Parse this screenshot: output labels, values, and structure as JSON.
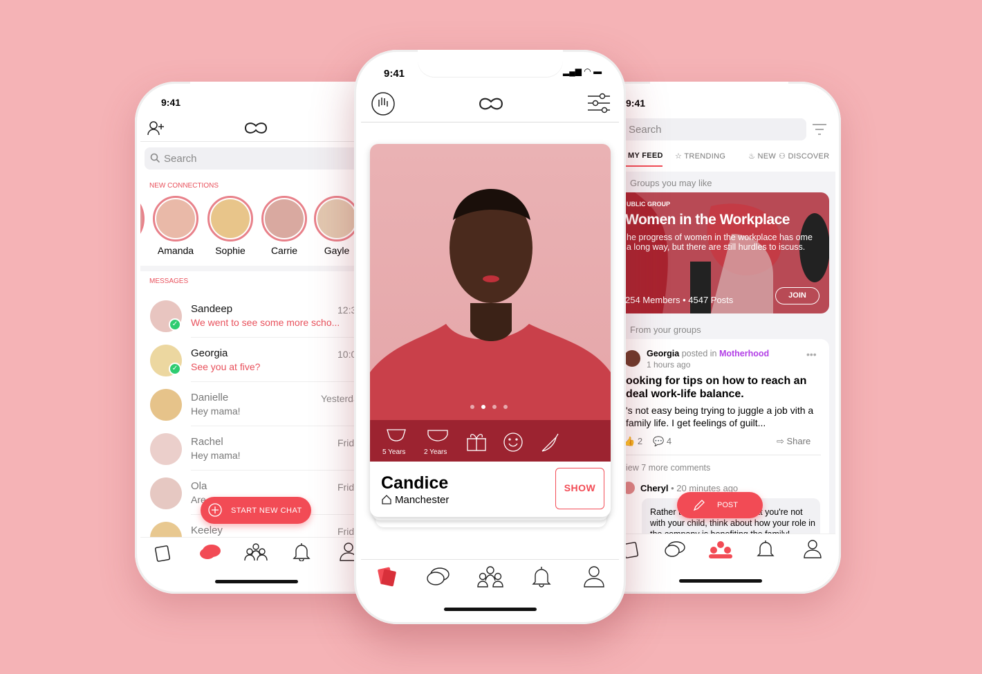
{
  "colors": {
    "background": "#f5b3b6",
    "accent": "#f24b55",
    "badge": "#2ecc71",
    "purple": "#b23fe6"
  },
  "status_time": "9:41",
  "messages_screen": {
    "search_placeholder": "Search",
    "new_connections_label": "NEW CONNECTIONS",
    "connections": [
      {
        "name": "Amanda"
      },
      {
        "name": "Sophie"
      },
      {
        "name": "Carrie"
      },
      {
        "name": "Gayle"
      }
    ],
    "messages_label": "MESSAGES",
    "messages": [
      {
        "name": "Sandeep",
        "preview": "We went to see some more scho...",
        "time": "12:3",
        "unread": true
      },
      {
        "name": "Georgia",
        "preview": "See you at five?",
        "time": "10:0",
        "unread": true
      },
      {
        "name": "Danielle",
        "preview": "Hey mama!",
        "time": "Yesterda",
        "unread": false
      },
      {
        "name": "Rachel",
        "preview": "Hey mama!",
        "time": "Frida",
        "unread": false
      },
      {
        "name": "Ola",
        "preview": "Are",
        "time": "Frida",
        "unread": false
      },
      {
        "name": "Keeley",
        "preview": "",
        "time": "Frida",
        "unread": false
      }
    ],
    "fab_label": "START NEW CHAT"
  },
  "profile_screen": {
    "name": "Candice",
    "location": "Manchester",
    "show_label": "SHOW",
    "photo_page": 2,
    "photo_count": 4,
    "children": [
      {
        "label": "5 Years",
        "icon": "bib-icon"
      },
      {
        "label": "2 Years",
        "icon": "diaper-icon"
      }
    ],
    "interest_icons": [
      "gift-icon",
      "smile-icon",
      "chili-icon"
    ]
  },
  "feed_screen": {
    "search_placeholder": "Search",
    "tabs": [
      {
        "label": "MY FEED",
        "active": true
      },
      {
        "label": "TRENDING"
      },
      {
        "label": "NEW"
      },
      {
        "label": "DISCOVER"
      }
    ],
    "groups_heading": "Groups you may like",
    "group": {
      "type": "UBLIC GROUP",
      "title": "Women in the Workplace",
      "description": "he progress of women in the workplace has ome a long way, but there are still hurdles to iscuss.",
      "stats": "254 Members • 4547 Posts",
      "join_label": "JOIN"
    },
    "from_groups_heading": "From your groups",
    "post": {
      "author": "Georgia",
      "posted_in": "posted in",
      "group": "Motherhood",
      "time": "1 hours ago",
      "title": "ooking for tips on how to reach an deal work-life balance.",
      "body": "'s not easy being trying to juggle a job vith a family life. I get feelings of guilt...",
      "likes": "2",
      "comments": "4",
      "share_label": "Share",
      "more_comments": "iew 7 more comments"
    },
    "comment": {
      "author": "Cheryl",
      "time": "• 20 minutes ago",
      "text": "Rather than feeling guilty that you're not with your child, think about how your role in the company is benefiting the family!"
    },
    "post_button": "POST"
  }
}
